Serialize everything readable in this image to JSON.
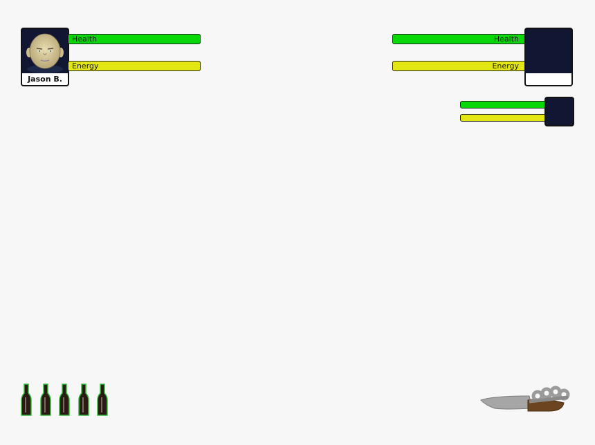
{
  "player": {
    "name": "Jason B.",
    "health_label": "Health",
    "energy_label": "Energy",
    "health_fraction": 1.0,
    "energy_fraction": 1.0
  },
  "enemy": {
    "name": "",
    "health_label": "Health",
    "energy_label": "Energy",
    "health_fraction": 1.0,
    "energy_fraction": 1.0
  },
  "enemy2": {
    "health_fraction": 1.0,
    "energy_fraction": 1.0
  },
  "inventory": {
    "bottles_count": 5,
    "weapon": "knife-with-brass-knuckles"
  },
  "colors": {
    "health": "#08d708",
    "energy": "#e2e612",
    "portrait_bg": "#111633"
  }
}
